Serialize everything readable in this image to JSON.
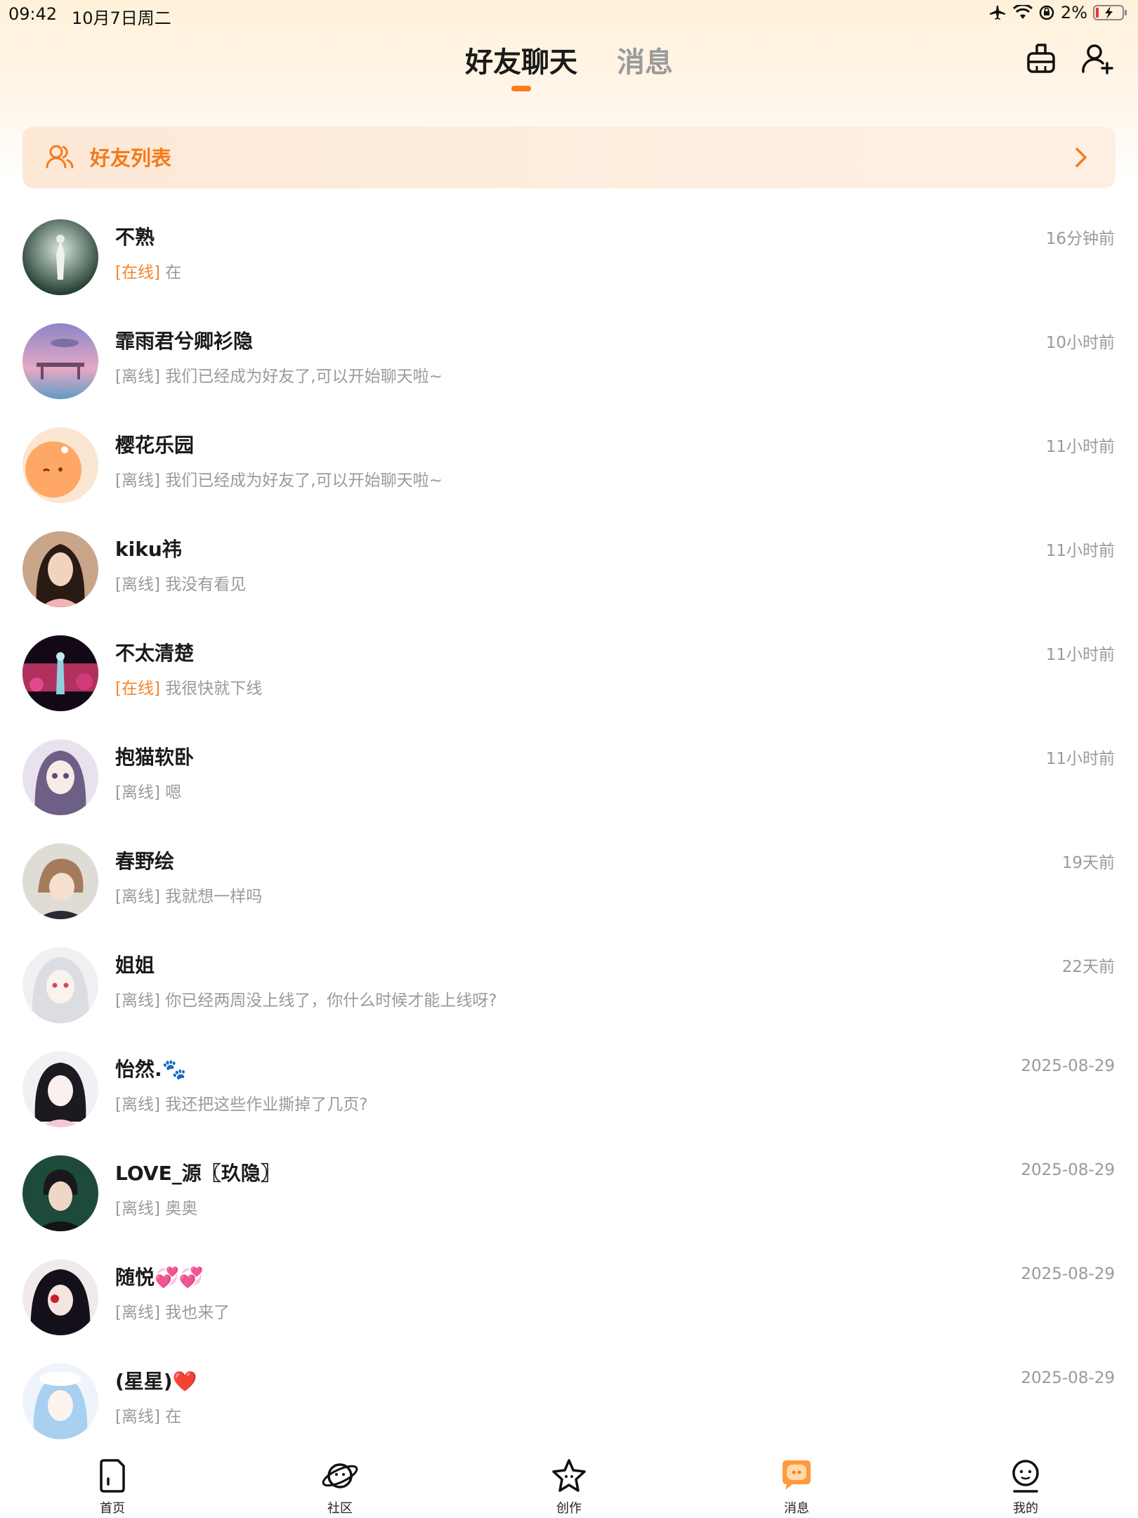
{
  "status_bar": {
    "time": "09:42",
    "date": "10月7日周二",
    "battery": "2%",
    "icons": [
      "airplane-icon",
      "wifi-icon",
      "rotation-lock-icon",
      "battery-charging-icon"
    ]
  },
  "header": {
    "tabs": [
      {
        "label": "好友聊天",
        "active": true
      },
      {
        "label": "消息",
        "active": false
      }
    ],
    "right_icons": [
      "clean-icon",
      "add-friend-icon"
    ]
  },
  "friend_list_bar": {
    "label": "好友列表",
    "icon": "friends-icon",
    "arrow": "chevron-right-icon"
  },
  "colors": {
    "accent": "#ff7a18",
    "online": "#f5842a",
    "muted": "#9a9a9a"
  },
  "chats": [
    {
      "name": "不熟",
      "time": "16分钟前",
      "status": "[在线]",
      "online": true,
      "message": "在"
    },
    {
      "name": "霏雨君兮卿衫隐",
      "time": "10小时前",
      "status": "[离线]",
      "online": false,
      "message": "我们已经成为好友了,可以开始聊天啦~"
    },
    {
      "name": "樱花乐园",
      "time": "11小时前",
      "status": "[离线]",
      "online": false,
      "message": "我们已经成为好友了,可以开始聊天啦~"
    },
    {
      "name": "kiku祎",
      "time": "11小时前",
      "status": "[离线]",
      "online": false,
      "message": "我没有看见"
    },
    {
      "name": "不太清楚",
      "time": "11小时前",
      "status": "[在线]",
      "online": true,
      "message": "我很快就下线"
    },
    {
      "name": "抱猫软卧",
      "time": "11小时前",
      "status": "[离线]",
      "online": false,
      "message": "嗯"
    },
    {
      "name": "春野绘",
      "time": "19天前",
      "status": "[离线]",
      "online": false,
      "message": "我就想一样吗"
    },
    {
      "name": "姐姐",
      "time": "22天前",
      "status": "[离线]",
      "online": false,
      "message": "你已经两周没上线了，你什么时候才能上线呀?"
    },
    {
      "name": "怡然.🐾",
      "time": "2025-08-29",
      "status": "[离线]",
      "online": false,
      "message": "我还把这些作业撕掉了几页?"
    },
    {
      "name": "LOVE_源〖玖隐〗",
      "time": "2025-08-29",
      "status": "[离线]",
      "online": false,
      "message": "奥奥"
    },
    {
      "name": "随悦💞💞",
      "time": "2025-08-29",
      "status": "[离线]",
      "online": false,
      "message": "我也来了"
    },
    {
      "name": "(星星)❤️",
      "time": "2025-08-29",
      "status": "[离线]",
      "online": false,
      "message": "在"
    }
  ],
  "bottom_nav": [
    {
      "label": "首页",
      "icon": "home-icon",
      "active": false
    },
    {
      "label": "社区",
      "icon": "planet-icon",
      "active": false
    },
    {
      "label": "创作",
      "icon": "star-create-icon",
      "active": false
    },
    {
      "label": "消息",
      "icon": "message-icon",
      "active": true
    },
    {
      "label": "我的",
      "icon": "profile-icon",
      "active": false
    }
  ]
}
